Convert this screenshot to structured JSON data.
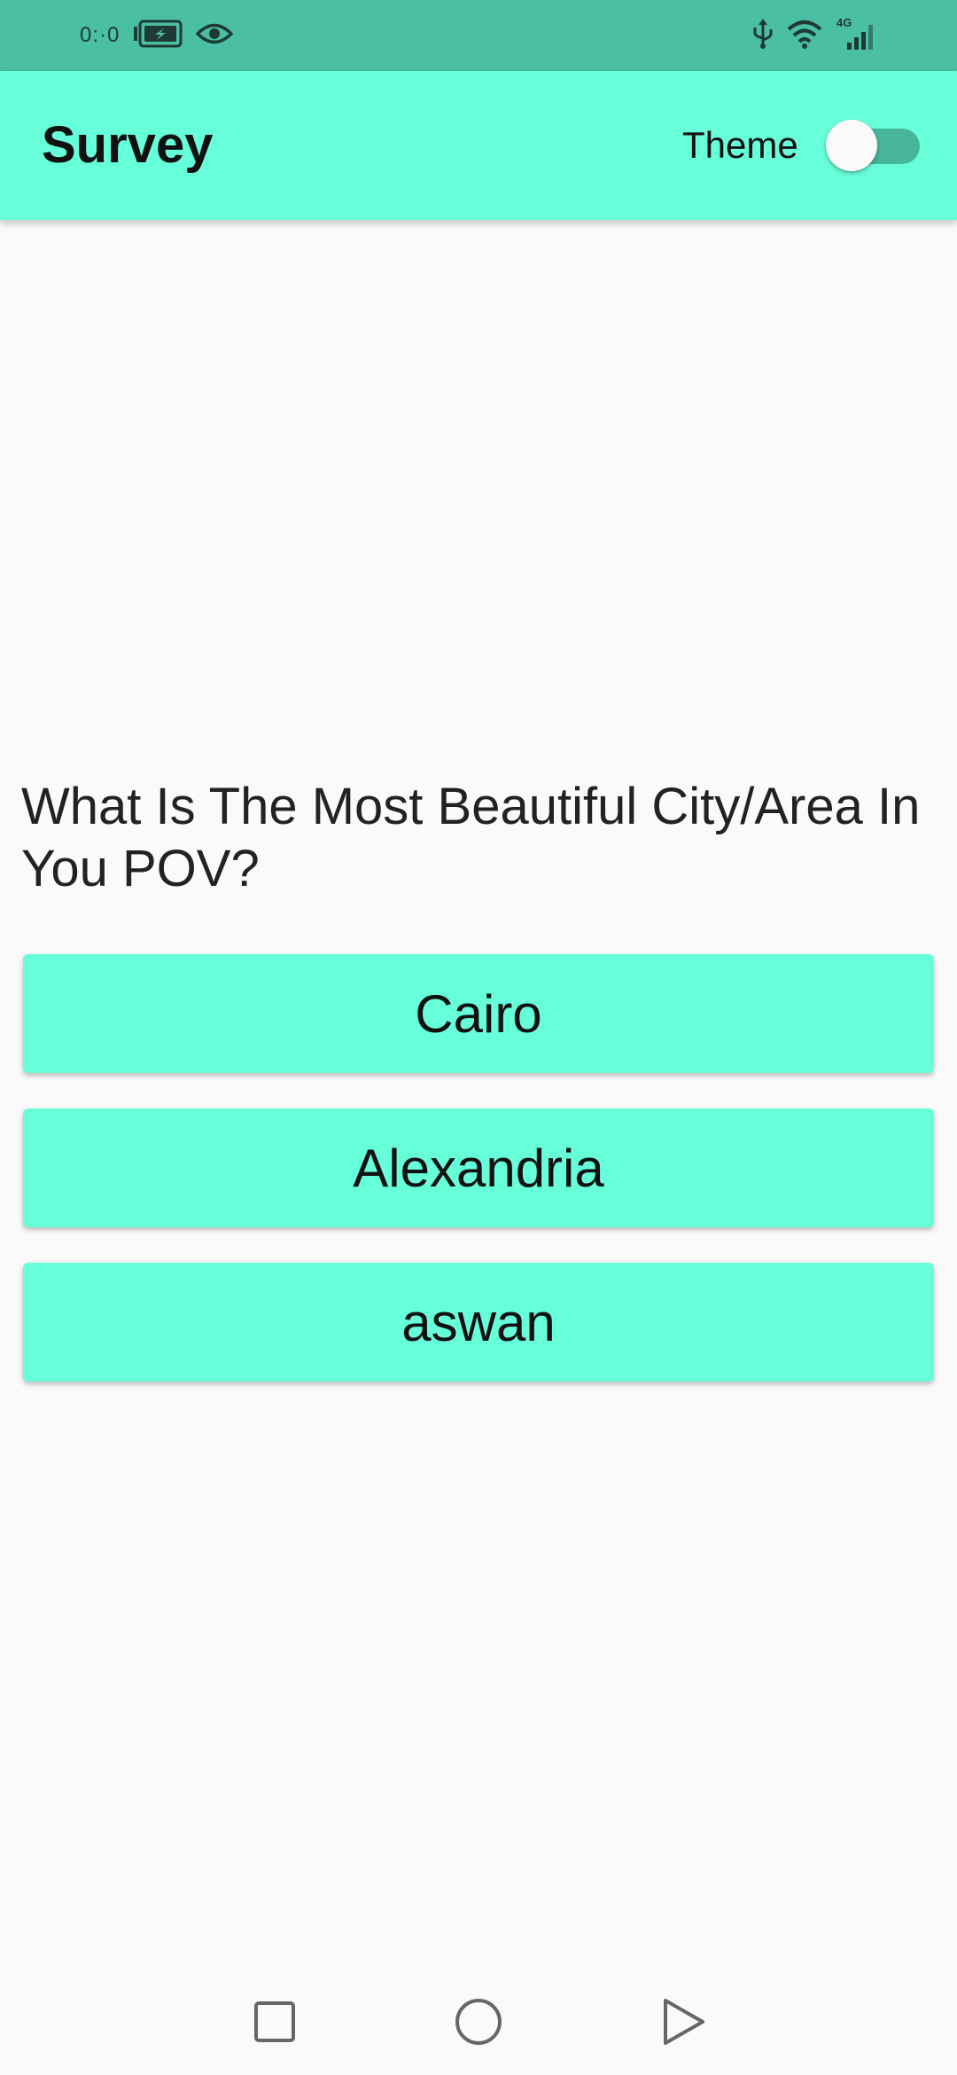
{
  "status_bar": {
    "time": "0:·0",
    "icons": [
      "battery-charging-icon",
      "eye-icon",
      "usb-icon",
      "wifi-icon",
      "signal-4g-icon"
    ],
    "network_label": "4G"
  },
  "app_bar": {
    "title": "Survey",
    "theme_label": "Theme",
    "theme_toggle_on": false
  },
  "question": {
    "text": "What Is The Most Beautiful City/Area In You POV?"
  },
  "answers": [
    {
      "label": "Cairo"
    },
    {
      "label": "Alexandria"
    },
    {
      "label": "aswan"
    }
  ],
  "nav_bar": {
    "icons": [
      "recents-square-icon",
      "home-circle-icon",
      "back-triangle-icon"
    ]
  },
  "colors": {
    "status_bar": "#4bbfa4",
    "app_bar": "#66ffda",
    "button": "#66ffda",
    "background": "#fafafa",
    "toggle_track": "#46b59a"
  }
}
